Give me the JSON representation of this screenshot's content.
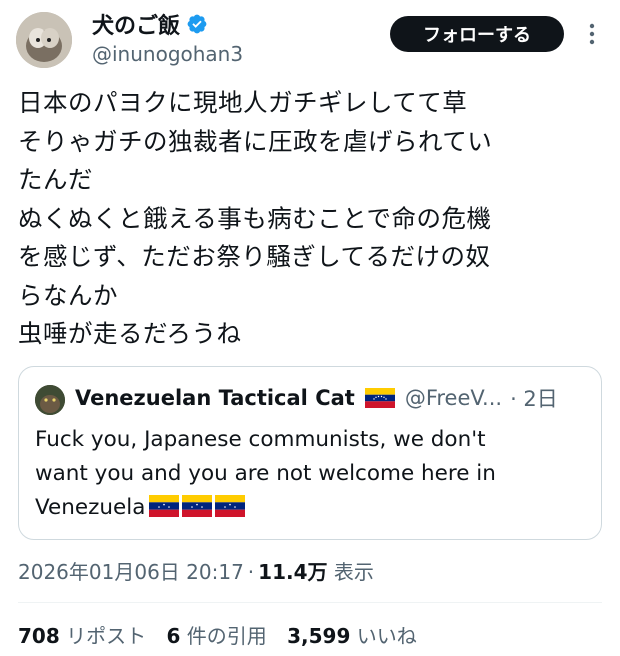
{
  "author": {
    "display_name": "犬のご飯",
    "handle": "@inunogohan3",
    "verified_icon": "verified-badge-icon",
    "verified_color": "#1d9bf0"
  },
  "follow_label": "フォローする",
  "more_icon": "more-vertical-icon",
  "tweet_lines": [
    "日本のパヨクに現地人ガチギレしてて草",
    "そりゃガチの独裁者に圧政を虐げられてい",
    "たんだ",
    "ぬくぬくと餓える事も病むことで命の危機",
    "を感じず、ただお祭り騒ぎしてるだけの奴",
    "らなんか",
    "虫唾が走るだろうね"
  ],
  "quote": {
    "display_name": "Venezuelan Tactical Cat",
    "handle": "@FreeV...",
    "time": "· 2日",
    "flag_icon": "venezuela-flag-icon",
    "text_lines": [
      "Fuck you, Japanese communists, we don't",
      "want you and you are not welcome here in",
      "Venezuela"
    ]
  },
  "meta": {
    "timestamp": "2026年01月06日 20:17",
    "separator": "·",
    "views_count": "11.4万",
    "views_label": "表示"
  },
  "stats": {
    "reposts_count": "708",
    "reposts_label": "リポスト",
    "quotes_count": "6",
    "quotes_label": "件の引用",
    "likes_count": "3,599",
    "likes_label": "いいね"
  },
  "colors": {
    "text": "#0f1419",
    "secondary": "#536471",
    "border": "#cfd9de",
    "button_bg": "#0f1419"
  }
}
